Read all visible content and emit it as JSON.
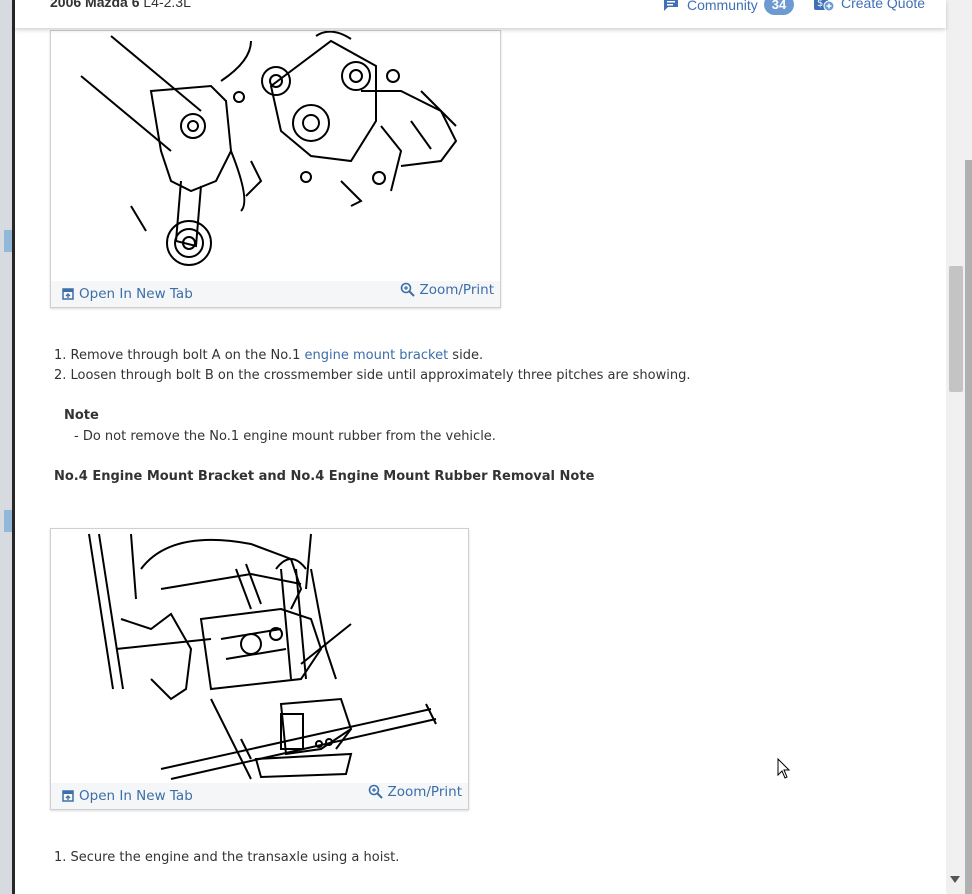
{
  "header": {
    "vehicle_bold": "2006 Mazda 6",
    "vehicle_engine": "L4-2.3L",
    "community_label": "Community",
    "community_count": "34",
    "create_quote_label": "Create Quote"
  },
  "figure1": {
    "open_tab_label": "Open In New Tab",
    "zoom_label": "Zoom/Print"
  },
  "steps1": {
    "step1_prefix": "1. Remove through bolt A on the No.1 ",
    "step1_link": "engine mount bracket",
    "step1_suffix": " side.",
    "step2": "2. Loosen through bolt B on the crossmember side until approximately three pitches are showing."
  },
  "note": {
    "title": "Note",
    "item": "-  Do not remove the No.1 engine mount rubber from the vehicle."
  },
  "section_heading": "No.4 Engine Mount Bracket and No.4 Engine Mount Rubber Removal Note",
  "figure2": {
    "open_tab_label": "Open In New Tab",
    "zoom_label": "Zoom/Print"
  },
  "steps2": {
    "step1": "1. Secure the engine and the transaxle using a hoist."
  },
  "colors": {
    "link": "#3c6ea8",
    "badge": "#6d9bd1"
  },
  "icons": [
    "community-icon",
    "create-quote-icon",
    "open-new-tab-icon",
    "zoom-icon",
    "mouse-cursor-icon"
  ]
}
